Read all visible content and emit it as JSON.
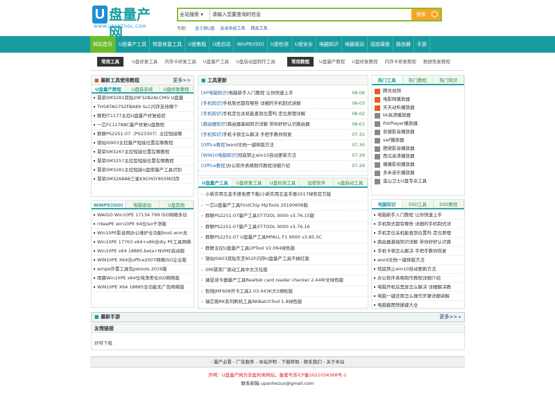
{
  "header": {
    "logo_u": "U",
    "logo_text": "盘量产网",
    "logo_url": "WWW.UPANTOOL.COM",
    "search_select": "全站搜索",
    "search_placeholder": "请输入您要查询的信息",
    "search_button": "搜索",
    "topics_label": "专题：",
    "topics": [
      "金士顿U盘",
      "安卓系统工具",
      "精品工具"
    ]
  },
  "nav": [
    "网站首页",
    "U盘量产工具",
    "恢复修复工具",
    "U盘教程",
    "U盘启动",
    "WinPE(ISO)",
    "U盘检测",
    "U盘安全",
    "电脑知识",
    "电脑驱动",
    "固态硬盘",
    "路由器",
    "手游"
  ],
  "subbar": {
    "tool_tag": "常用工具",
    "tool_links": [
      "U盘修复工具",
      "内存卡修复工具",
      "U盘量产工具",
      "U盘启动盘制作工具"
    ],
    "tutorial_tag": "常用教程",
    "tutorial_links": [
      "U盘量产教程",
      "U盘修复教程",
      "内存卡修复教程",
      "数据恢复教程"
    ]
  },
  "left_top": {
    "title": "最新工具使用教程",
    "more": "更多>>",
    "tabs": [
      "U盘量产教程",
      "U盘装系统",
      "U盘修复教程"
    ],
    "items": [
      "慧荣SM3281双贴29F32B2ALCMG U盘量",
      "TH58TAG7S2FBA89 SLC闪存支持哪个",
      "联阳IT1177主控U盘量产修复经验",
      "一芯FC1178BC量产修复U盘教程",
      "群联PS2251-07（PS23307）主控短接哪",
      "银灿IS903主控量产短接位置在哪教程",
      "慧荣SM3267主控短接位置在哪教程",
      "慧荣SM3257主控型短接位置在哪教程",
      "慧荣SM3281主控短接U盘使量产工具识别",
      "慧荣SM3268AB三星K9CHGY8S5M闪存"
    ]
  },
  "left_bottom": {
    "tabs": [
      "WINPE(ISO)",
      "电脑驱动",
      "U盘其他"
    ],
    "items": [
      "WAIGO Win10PE 17134.799 ISO网络多功",
      "rrkeePE win10PE 64位iso干净版",
      "Win10PE影音网办公维护全功能boot.wim无",
      "Win10PE 17763 x64+x86合diy PE工具网络",
      "Win10PE x64 18885.beta+NVME启动版",
      "WIN10PE X64含office2007网络ISO企业版",
      "winpe外置工具包petools 2019版",
      "雨晨Win10PE x64位纯净美化ISO网络版",
      "WIN10PE X64 18885全功能无广告网络版"
    ]
  },
  "center_top": {
    "title": "工具更新",
    "items": [
      {
        "cat": "[XP电脑知识]",
        "text": "电脑新手入门教程 让你快速上手",
        "date": "08-06"
      },
      {
        "cat": "[手机知识]",
        "text": "手机制式都有哪些 详细的手机制式讲解",
        "date": "08-03"
      },
      {
        "cat": "[手机知识]",
        "text": "手机定位关机能查到位置吗 定位原理详解",
        "date": "08-02"
      },
      {
        "cat": "[路由器知识]",
        "text": "路由器基础知识详解 带你好好认识路由器",
        "date": "08-01"
      },
      {
        "cat": "[手机知识]",
        "text": "手机卡顿怎么解决 手把手教你恢复",
        "date": "07-31"
      },
      {
        "cat": "[Office教程]",
        "text": "word文档一键排版方法",
        "date": "07-30"
      },
      {
        "cat": "[WIN10电脑知识]",
        "text": "彻底禁止win10自动更新方法",
        "date": "07-29"
      },
      {
        "cat": "[Office教程]",
        "text": "办公软件表格制作教程详细介绍",
        "date": "07-28"
      }
    ]
  },
  "center_tools": {
    "tabs": [
      "U盘量产工具",
      "U盘修复工具",
      "U盘检测工具",
      "加密软件",
      "u盘启动工具"
    ],
    "items": [
      "小新实用五金手册免费下载|小新实用五金手册2017绿色官方版",
      "一芯U盘量产工具FirstChip MpTools 20190606版",
      "群联PS2251-07量产工具ST-TOOL 9000 v3.76.15版",
      "群联PS2251-07量产工具ST-TOOL 9000 v3.76.16",
      "群联PS2251-07 U盘量产工具MPALL F1 9000 v3.85.0C",
      "群联主控U盘量产工具UPTool V2.094绿色版",
      "银灿IS903双贴东芝852F闪存U盘量产工具不掉红版",
      "SMI慧荣厂驱动工具中文汉化版",
      "瑞昱读卡器量产工具Realtek card reader checker 2.44中文绿色版",
      "智微JMF608开卡工具2.03.043K大S顺粒版",
      "瑞芯微RK系列刷机工具RKBatchTool 1.8绿色版"
    ]
  },
  "right_top": {
    "tabs": [
      "热门工具",
      "热门教程",
      "热门知识"
    ],
    "items": [
      "腾讯视频",
      "电影网播放器",
      "天天动听播放器",
      "kk高清播放器",
      "PotPlayer播放器",
      "安捷影音播放器",
      "swf播放器",
      "肥佬影音播放器",
      "西瓜高清播放器",
      "播播影视播放器",
      "多米音乐播放器",
      "金山卫士U盘专杀工具"
    ]
  },
  "right_bottom": {
    "tabs": [
      "电脑知识",
      "SSD工具",
      "SSD教程"
    ],
    "items": [
      "电脑新手入门教程 让你快速上手",
      "手机制式都有哪些 详细的手机制式详",
      "手机定位关机能查到位置吗 定位原理",
      "路由器基础知识详解 带你好好认识路",
      "手机卡顿怎么解决 手把手教你恢复",
      "word文档一键排版方法",
      "彻底禁止win10自动更新方法",
      "办公软件表格制作教程详细介绍",
      "电脑开机后黑屏怎么解决 详细解决教",
      "电脑一键还原怎么操作步骤详细讲解",
      "电脑截图快捷键大全"
    ]
  },
  "latest": {
    "title": "最新手游",
    "more": "更多>>"
  },
  "friend": {
    "title": "友情链接",
    "items": [
      "好特下载"
    ]
  },
  "footer": {
    "nav": "- 量产必看 - 广告服务 - 本站声明 - 下载帮助 - 联系我们 - 关于本站",
    "notice": "声明：U盘量产网为非盈利类网站，备案号苏ICP备2021034368号-1",
    "contact": "联系邮箱:upanhezuo@gmail.com"
  }
}
